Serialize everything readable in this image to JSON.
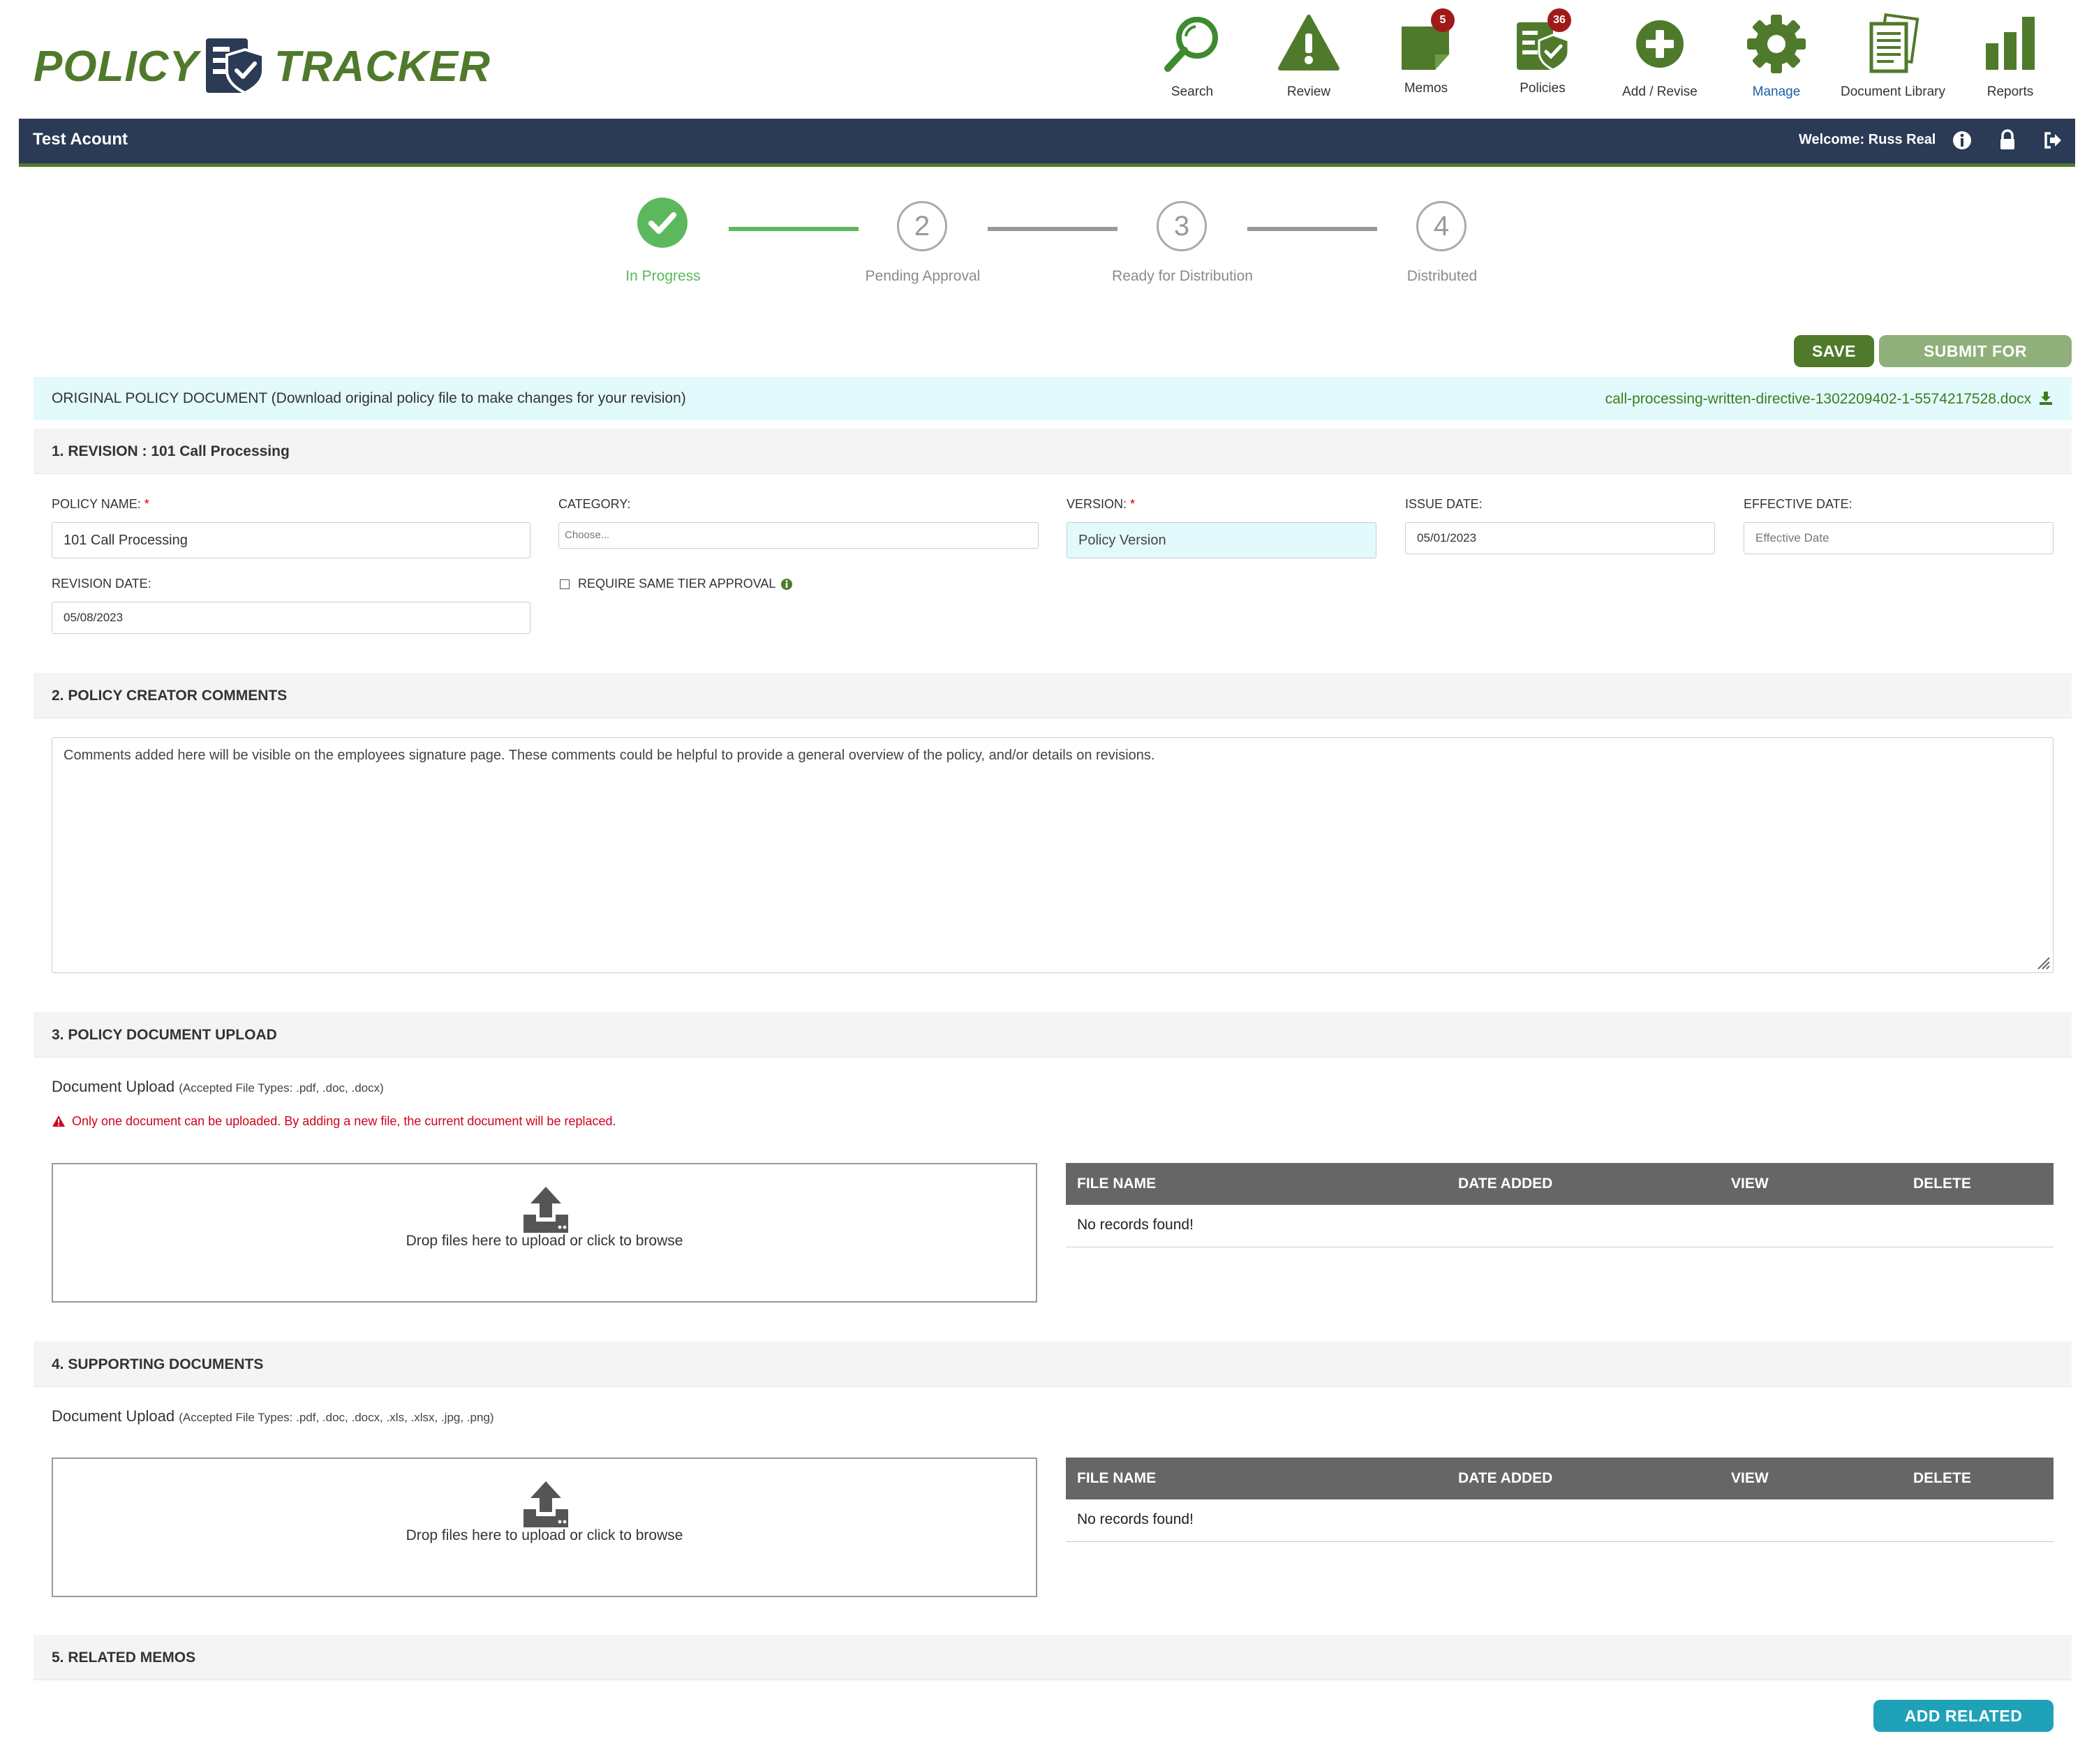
{
  "logo": {
    "word1": "POLICY",
    "word2": "TRACKER"
  },
  "nav": [
    {
      "label": "Search",
      "icon": "search-icon"
    },
    {
      "label": "Review",
      "icon": "warning-icon"
    },
    {
      "label": "Memos",
      "icon": "memo-icon",
      "badge": "5"
    },
    {
      "label": "Policies",
      "icon": "policy-icon",
      "badge": "36"
    },
    {
      "label": "Add / Revise",
      "icon": "plus-circle-icon"
    },
    {
      "label": "Manage",
      "icon": "gear-icon",
      "active": true
    },
    {
      "label": "Document Library",
      "icon": "documents-icon"
    },
    {
      "label": "Reports",
      "icon": "bar-chart-icon"
    }
  ],
  "topbar": {
    "account": "Test Acount",
    "welcome": "Welcome: Russ Real"
  },
  "stepper": [
    {
      "number": "",
      "label": "In Progress",
      "state": "done"
    },
    {
      "number": "2",
      "label": "Pending Approval",
      "state": "pending"
    },
    {
      "number": "3",
      "label": "Ready for Distribution",
      "state": "pending"
    },
    {
      "number": "4",
      "label": "Distributed",
      "state": "pending"
    }
  ],
  "buttons": {
    "save": "SAVE",
    "submit": "SUBMIT FOR APPROVAL",
    "add_memos": "ADD RELATED MEMOS"
  },
  "original_doc": {
    "text": "ORIGINAL POLICY DOCUMENT (Download original policy file to make changes for your revision)",
    "file": "call-processing-written-directive-1302209402-1-5574217528.docx"
  },
  "sections": {
    "s1": "1. REVISION : 101 Call Processing",
    "s2": "2. POLICY CREATOR COMMENTS",
    "s3": "3. POLICY DOCUMENT UPLOAD",
    "s4": "4. SUPPORTING DOCUMENTS",
    "s5": "5. RELATED MEMOS"
  },
  "form": {
    "policy_name_label": "POLICY NAME:",
    "policy_name_value": "101 Call Processing",
    "category_label": "CATEGORY:",
    "category_placeholder": "Choose...",
    "version_label": "VERSION:",
    "version_placeholder": "Policy Version",
    "issue_date_label": "ISSUE DATE:",
    "issue_date_value": "05/01/2023",
    "effective_date_label": "EFFECTIVE DATE:",
    "effective_date_placeholder": "Effective Date",
    "revision_date_label": "REVISION DATE:",
    "revision_date_value": "05/08/2023",
    "tier_label": "REQUIRE SAME TIER APPROVAL"
  },
  "comments_placeholder": "Comments added here will be visible on the employees signature page. These comments could be helpful to provide a general overview of the policy, and/or details on revisions.",
  "upload": {
    "doc_label": "Document Upload",
    "doc_types": "(Accepted File Types: .pdf, .doc, .docx)",
    "warning": "Only one document can be uploaded. By adding a new file, the current document will be replaced.",
    "drop_text": "Drop files here to upload or click to browse",
    "support_label": "Document Upload",
    "support_types": "(Accepted File Types: .pdf, .doc, .docx, .xls, .xlsx, .jpg, .png)"
  },
  "table": {
    "headers": [
      "FILE NAME",
      "DATE ADDED",
      "VIEW",
      "DELETE"
    ],
    "empty": "No records found!"
  },
  "colors": {
    "brand_green": "#4f7a2b",
    "navy": "#2b3a55",
    "step_green": "#5cb85c",
    "teal": "#1fa2b8"
  }
}
